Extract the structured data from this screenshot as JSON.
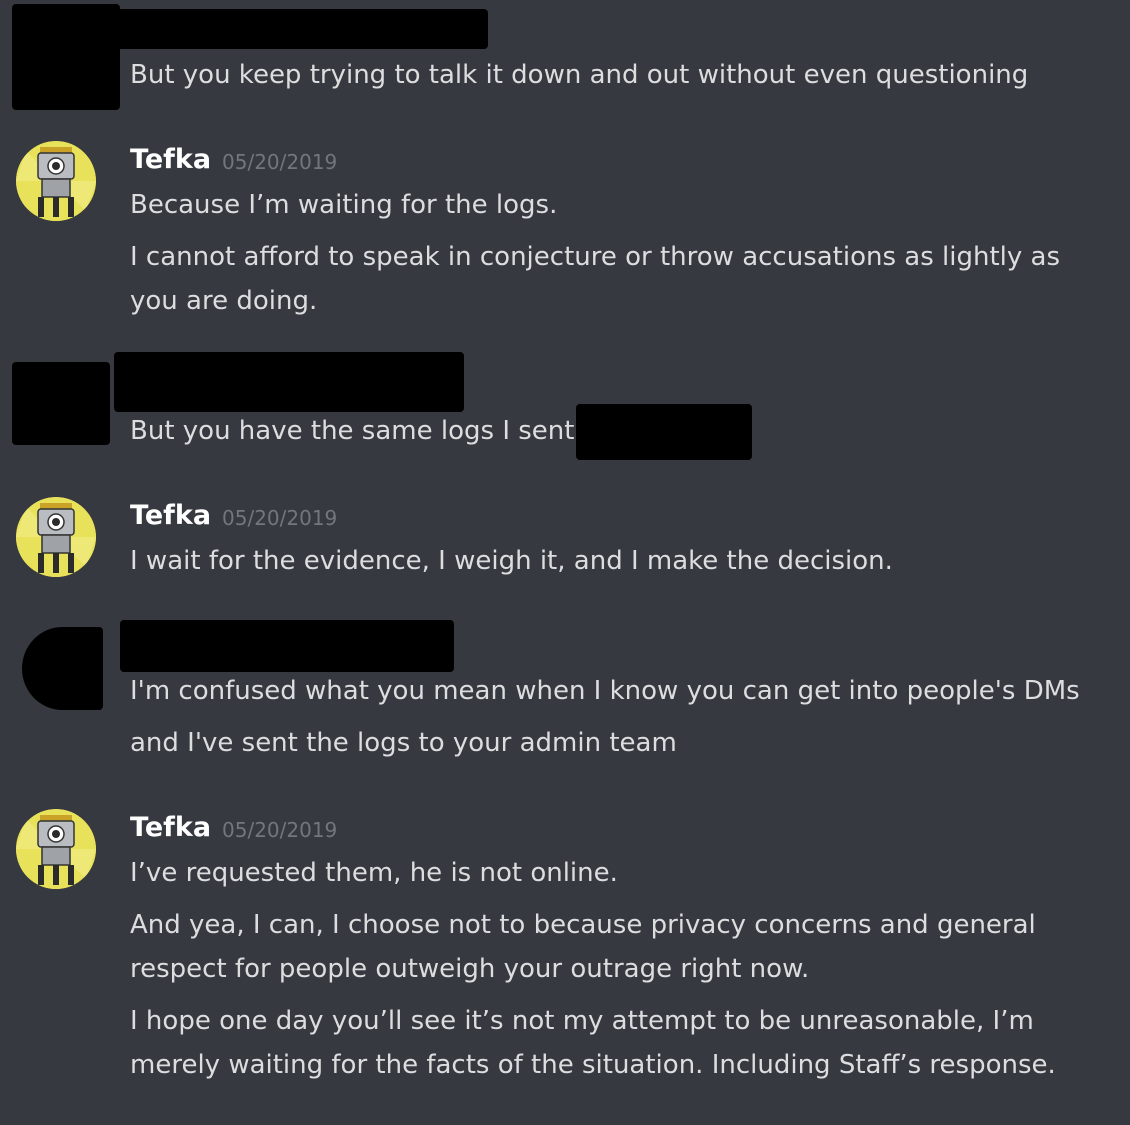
{
  "messages": [
    {
      "author": "",
      "lines": [
        "But you keep trying to talk it down and out without even questioning"
      ]
    },
    {
      "author": "Tefka",
      "timestamp": "05/20/2019",
      "lines": [
        "Because I’m waiting for the logs.",
        "I cannot afford to speak in conjecture or throw accusations as lightly as",
        "you are doing."
      ]
    },
    {
      "author": "",
      "lines": [
        "But you have the same logs I sent"
      ]
    },
    {
      "author": "Tefka",
      "timestamp": "05/20/2019",
      "lines": [
        "I wait for the evidence, I weigh it, and I make the decision."
      ]
    },
    {
      "author": "",
      "lines": [
        "I'm confused what you mean when I know you can get into people's DMs",
        "and I've sent the logs to your admin team"
      ]
    },
    {
      "author": "Tefka",
      "timestamp": "05/20/2019",
      "lines": [
        "I’ve requested them, he is not online.",
        "And yea, I can, I choose not to because privacy concerns and general",
        "respect for people outweigh your outrage right now.",
        "I hope one day you’ll see it’s not my attempt to be unreasonable, I’m",
        "merely waiting for the facts of the situation. Including Staff’s response."
      ]
    }
  ],
  "avatar_icon": "robot-avatar-icon",
  "colors": {
    "background": "#36393f",
    "username": "#ffffff",
    "timestamp": "#72767d",
    "text": "#dcddde",
    "redaction": "#000000",
    "avatar_bg": "#e8e25a"
  }
}
